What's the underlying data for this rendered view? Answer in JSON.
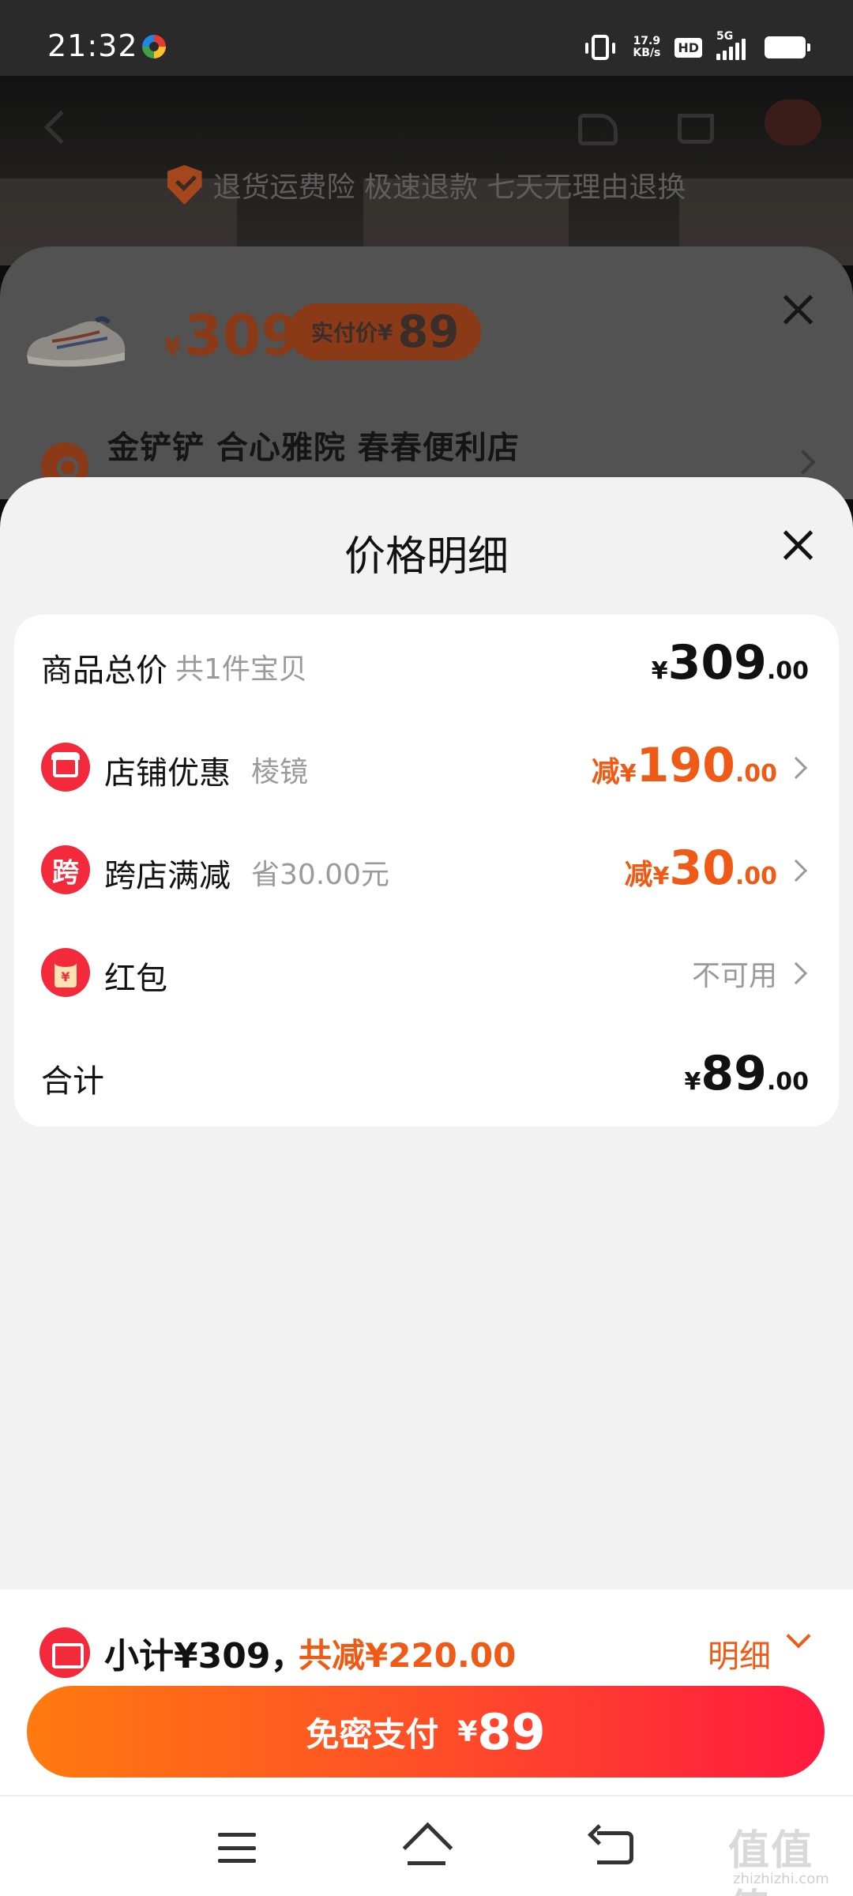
{
  "status_bar": {
    "time": "21:32",
    "net_speed": "17.9",
    "net_unit": "KB/s",
    "hd": "HD",
    "network": "5G",
    "icons": [
      "app-notification-icon",
      "vibrate-icon",
      "signal-icon",
      "battery-icon"
    ]
  },
  "background_page": {
    "guarantee_text": "退货运费险 极速退款 七天无理由退换",
    "icons": [
      "back-icon",
      "share-icon",
      "cart-icon",
      "shield-icon"
    ]
  },
  "back_sheet": {
    "price_currency": "¥",
    "price": "309",
    "paid_label": "实付价",
    "paid_currency": "¥",
    "paid_amount": "89",
    "address": "金铲铲 合心雅院 春春便利店"
  },
  "price_detail": {
    "title": "价格明细",
    "rows": [
      {
        "label": "商品总价",
        "sub": "共1件宝贝",
        "currency": "¥",
        "int": "309",
        "dec": ".00"
      },
      {
        "label": "店铺优惠",
        "sub": "棱镜",
        "prefix": "减",
        "currency": "¥",
        "int": "190",
        "dec": ".00"
      },
      {
        "label": "跨店满减",
        "icon_text": "跨",
        "sub": "省30.00元",
        "prefix": "减",
        "currency": "¥",
        "int": "30",
        "dec": ".00"
      },
      {
        "label": "红包",
        "icon_text": "¥",
        "status": "不可用"
      },
      {
        "label": "合计",
        "currency": "¥",
        "int": "89",
        "dec": ".00"
      }
    ]
  },
  "bottom_bar": {
    "subtotal": "小计¥309，",
    "reduced": "共减¥220.00",
    "detail_label": "明细",
    "pay_label": "免密支付",
    "pay_currency": "¥",
    "pay_amount": "89"
  },
  "watermark": {
    "text": "值值值",
    "sub": "zhizhizhi.com"
  },
  "colors": {
    "accent_orange": "#ef5b16",
    "accent_red": "#f32a3b",
    "pay_gradient_start": "#ff7a0f",
    "pay_gradient_end": "#ff1a3f",
    "sheet_background": "#f2f2f2"
  }
}
